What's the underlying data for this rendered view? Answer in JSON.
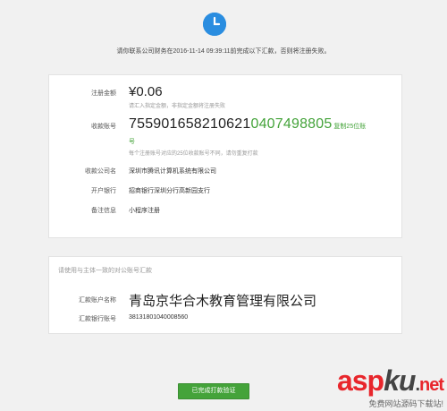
{
  "notice": "请你联系公司财务在2016-11-14 09:39:11前完成以下汇款，否则将注册失败。",
  "payment": {
    "amount_label": "注册金额",
    "amount": "¥0.06",
    "amount_hint": "请汇入指定金额，非指定金额将注册失败",
    "account_label": "收款账号",
    "account_part1": "755901658210621",
    "account_part2": "0407498805",
    "copy_label": "复制25位账",
    "account_cont": "号",
    "account_hint": "每个注册账号对应的25位收款账号不同，请勿重复打款",
    "payee_label": "收款公司名",
    "payee": "深圳市腾讯计算机系统有限公司",
    "bank_label": "开户银行",
    "bank": "招商银行深圳分行高新园支行",
    "remark_label": "备注信息",
    "remark": "小程序注册"
  },
  "payer": {
    "tip": "请使用与主体一致的对公账号汇款",
    "name_label": "汇款账户名称",
    "name": "青岛京华合木教育管理有限公司",
    "account_label": "汇款银行账号",
    "account": "38131801040008560"
  },
  "confirm_button": "已完成打款验证",
  "watermark": {
    "asp": "asp",
    "ku": "ku",
    "dot": ".",
    "net": "net",
    "sub": "免费网站源码下载站!"
  },
  "colors": {
    "accent": "#44a33a",
    "clock": "#2a8de0"
  }
}
